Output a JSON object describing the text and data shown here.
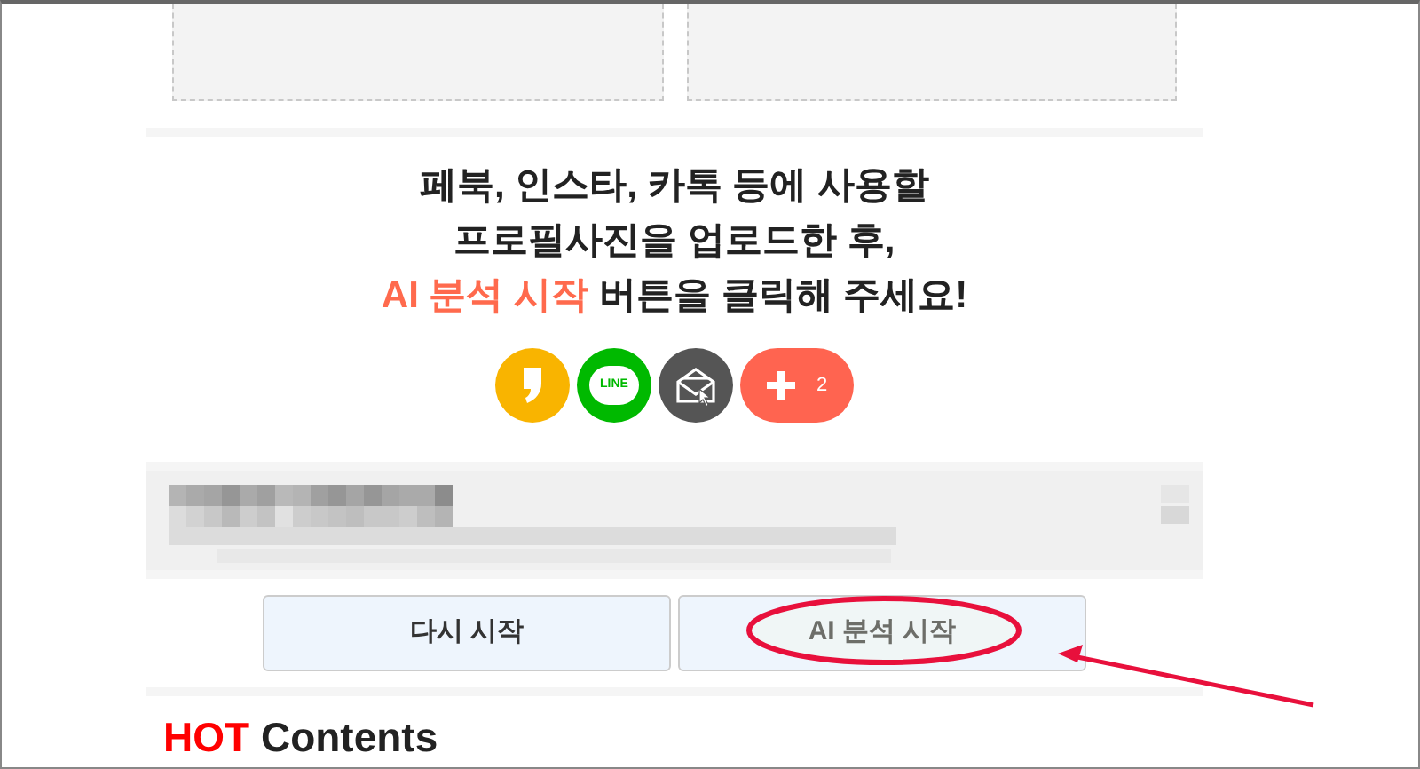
{
  "upload_slots": [
    {
      "kind": "empty"
    },
    {
      "kind": "empty"
    }
  ],
  "instructions": {
    "lines": [
      "페북, 인스타, 카톡 등에 사용할",
      "프로필사진을 업로드한 후,"
    ],
    "highlight": "AI 분석 시작",
    "rest": "버튼을 클릭해 주세요!"
  },
  "share_buttons": [
    {
      "kind": "kakaostory"
    },
    {
      "kind": "line",
      "label": "LINE"
    },
    {
      "kind": "email"
    },
    {
      "kind": "more",
      "count": "2"
    }
  ],
  "buttons": [
    {
      "label": "다시 시작"
    },
    {
      "label": "AI 분석 시작"
    }
  ],
  "section_title": {
    "highlight": "HOT",
    "rest": "Contents"
  }
}
